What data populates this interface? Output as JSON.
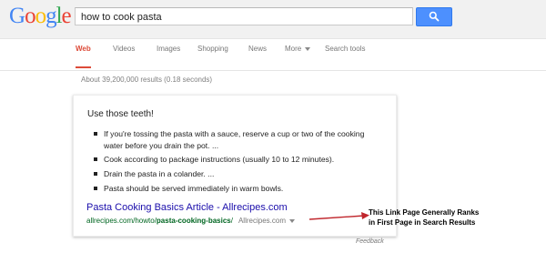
{
  "header": {
    "logo": "Google",
    "logo_letters": [
      "G",
      "o",
      "o",
      "g",
      "l",
      "e"
    ],
    "logo_colors": [
      "#4285f4",
      "#ea4335",
      "#fbbc05",
      "#4285f4",
      "#34a853",
      "#ea4335"
    ],
    "search_value": "how to cook pasta",
    "search_button_icon": "magnifier-icon"
  },
  "tabs": [
    {
      "label": "Web",
      "active": true
    },
    {
      "label": "Videos",
      "active": false
    },
    {
      "label": "Images",
      "active": false
    },
    {
      "label": "Shopping",
      "active": false
    },
    {
      "label": "News",
      "active": false
    },
    {
      "label": "More",
      "active": false
    },
    {
      "label": "Search tools",
      "active": false
    }
  ],
  "results_stats": "About 39,200,000 results (0.18 seconds)",
  "answer_card": {
    "title": "Use those teeth!",
    "bullets": [
      "If you're tossing the pasta with a sauce, reserve a cup or two of the cooking water before you drain the pot. ...",
      "Cook according to package instructions (usually 10 to 12 minutes).",
      "Drain the pasta in a colander. ...",
      "Pasta should be served immediately in warm bowls."
    ],
    "result_title": "Pasta Cooking Basics Article - Allrecipes.com",
    "result_url_prefix": "allrecipes.com/howto/",
    "result_url_bold": "pasta-cooking-basics",
    "result_url_suffix": "/",
    "result_source": "Allrecipes.com"
  },
  "annotation": {
    "line1": "This Link Page Generally Ranks",
    "line2": "in First Page in Search Results",
    "arrow_color": "#c0262c"
  },
  "feedback": "Feedback"
}
